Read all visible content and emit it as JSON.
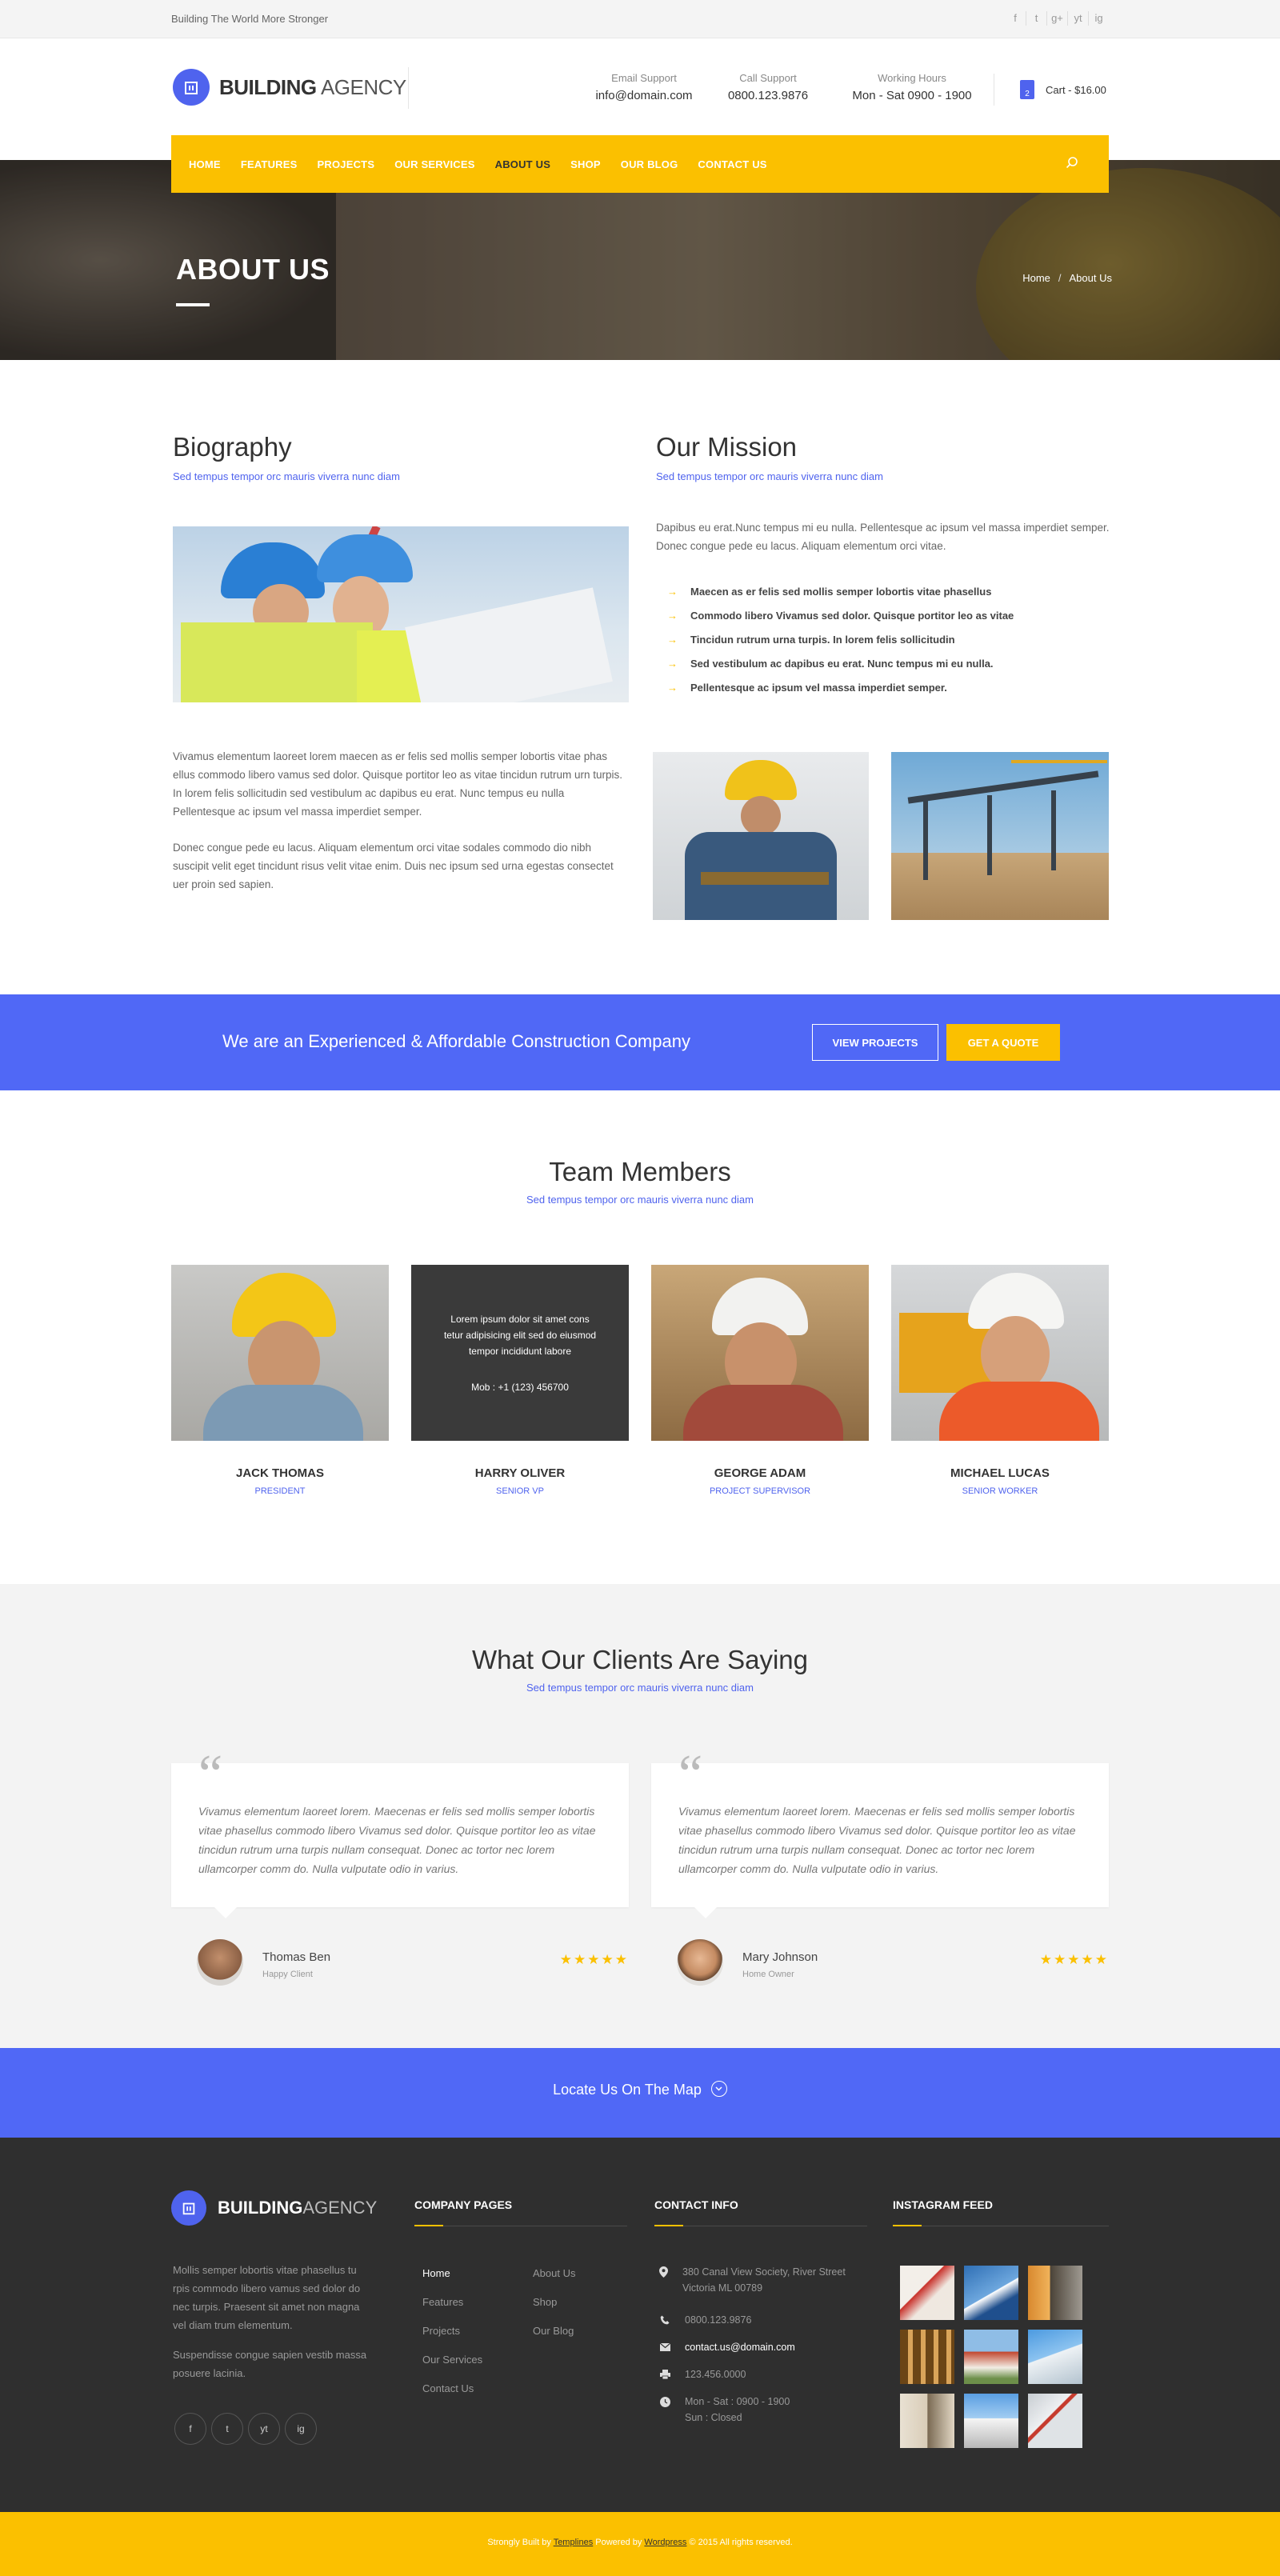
{
  "topbar": {
    "tagline": "Building The World More Stronger",
    "social": [
      "f",
      "t",
      "g+",
      "yt",
      "ig"
    ]
  },
  "header": {
    "logo_bold": "BUILDING",
    "logo_light": " AGENCY",
    "email": {
      "label": "Email Support",
      "value": "info@domain.com"
    },
    "call": {
      "label": "Call Support",
      "value": "0800.123.9876"
    },
    "hours": {
      "label": "Working Hours",
      "value": "Mon - Sat 0900 - 1900"
    },
    "cart": {
      "count": "2",
      "label": "Cart - $16.00"
    }
  },
  "nav": {
    "items": [
      "HOME",
      "FEATURES",
      "PROJECTS",
      "OUR SERVICES",
      "ABOUT US",
      "SHOP",
      "OUR BLOG",
      "CONTACT US"
    ],
    "active": "ABOUT US"
  },
  "hero": {
    "title": "ABOUT US",
    "crumb_home": "Home",
    "crumb_sep": "/",
    "crumb_current": "About Us"
  },
  "biography": {
    "title": "Biography",
    "subtitle": "Sed tempus tempor orc mauris viverra nunc diam",
    "p1": "Vivamus elementum laoreet lorem maecen as er felis sed mollis semper lobortis vitae phas ellus commodo libero vamus sed dolor. Quisque portitor leo as vitae tincidun rutrum urn turpis.  In lorem felis sollicitudin sed vestibulum ac dapibus eu erat. Nunc tempus eu nulla Pellentesque ac ipsum vel massa imperdiet semper.",
    "p2": "Donec congue pede eu lacus. Aliquam elementum orci vitae sodales commodo dio nibh suscipit velit eget tincidunt risus velit vitae enim. Duis nec ipsum sed urna egestas consectet uer proin sed sapien."
  },
  "mission": {
    "title": "Our Mission",
    "subtitle": "Sed tempus tempor orc mauris viverra nunc diam",
    "intro": "Dapibus eu erat.Nunc tempus mi eu nulla. Pellentesque ac ipsum vel massa imperdiet semper. Donec congue pede eu lacus. Aliquam elementum orci vitae.",
    "list": [
      "Maecen as er felis sed mollis semper lobortis vitae phasellus",
      "Commodo libero Vivamus sed dolor. Quisque portitor leo as vitae",
      "Tincidun rutrum urna turpis.  In lorem felis sollicitudin",
      "Sed vestibulum ac dapibus eu erat. Nunc tempus mi eu nulla.",
      "Pellentesque ac ipsum vel massa imperdiet semper."
    ]
  },
  "cta": {
    "text": "We are an Experienced & Affordable Construction Company",
    "btn1": "VIEW PROJECTS",
    "btn2": "GET A QUOTE"
  },
  "team": {
    "title": "Team Members",
    "subtitle": "Sed tempus tempor orc mauris viverra nunc diam",
    "hover_text": "Lorem ipsum dolor sit amet cons tetur adipisicing elit sed do eiusmod tempor incididunt labore",
    "hover_phone": "Mob  :  +1 (123) 456700",
    "members": [
      {
        "name": "JACK THOMAS",
        "role": "PRESIDENT"
      },
      {
        "name": "HARRY OLIVER",
        "role": "SENIOR VP"
      },
      {
        "name": "GEORGE ADAM",
        "role": "PROJECT SUPERVISOR"
      },
      {
        "name": "MICHAEL LUCAS",
        "role": "SENIOR WORKER"
      }
    ]
  },
  "testimonials": {
    "title": "What Our Clients Are Saying",
    "subtitle": "Sed tempus tempor orc mauris viverra nunc diam",
    "items": [
      {
        "text": "Vivamus elementum laoreet lorem. Maecenas er felis sed mollis semper lobortis vitae phasellus commodo libero Vivamus sed dolor. Quisque portitor leo as vitae tincidun rutrum urna turpis nullam consequat. Donec ac tortor nec lorem ullamcorper comm do. Nulla vulputate odio in varius.",
        "name": "Thomas Ben",
        "role": "Happy Client",
        "stars": "★★★★★"
      },
      {
        "text": "Vivamus elementum laoreet lorem. Maecenas er felis sed mollis semper lobortis vitae phasellus commodo libero Vivamus sed dolor. Quisque portitor leo as vitae tincidun rutrum urna turpis nullam consequat. Donec ac tortor nec lorem ullamcorper comm do. Nulla vulputate odio in varius.",
        "name": "Mary Johnson",
        "role": "Home Owner",
        "stars": "★★★★★"
      }
    ]
  },
  "map": {
    "label": "Locate Us On The Map"
  },
  "footer": {
    "logo_bold": "BUILDING",
    "logo_light": "AGENCY",
    "about1": "Mollis semper lobortis vitae phasellus tu rpis commodo libero vamus sed dolor do nec turpis. Praesent sit amet non magna vel diam trum elementum.",
    "about2": "Suspendisse congue sapien vestib massa posuere lacinia.",
    "company_title": "COMPANY PAGES",
    "links_col1": [
      "Home",
      "Features",
      "Projects",
      "Our Services",
      "Contact Us"
    ],
    "links_col2": [
      "About Us",
      "Shop",
      "Our Blog"
    ],
    "contact_title": "CONTACT INFO",
    "address": "380 Canal View Society, River Street Victoria ML 00789",
    "phone": "0800.123.9876",
    "email": "contact.us@domain.com",
    "fax": "123.456.0000",
    "hours1": "Mon - Sat : 0900 - 1900",
    "hours2": "Sun : Closed",
    "insta_title": "INSTAGRAM FEED",
    "social": [
      "f",
      "t",
      "yt",
      "ig"
    ]
  },
  "copyright": {
    "pre": "Strongly Built by ",
    "link1": "Templines",
    "mid": " Powered by ",
    "link2": "Wordpress",
    "post": "  © 2015 All rights reserved."
  },
  "colors": {
    "accent": "#4f63ee",
    "yellow": "#fbc000",
    "footer": "#2f2f2f"
  }
}
